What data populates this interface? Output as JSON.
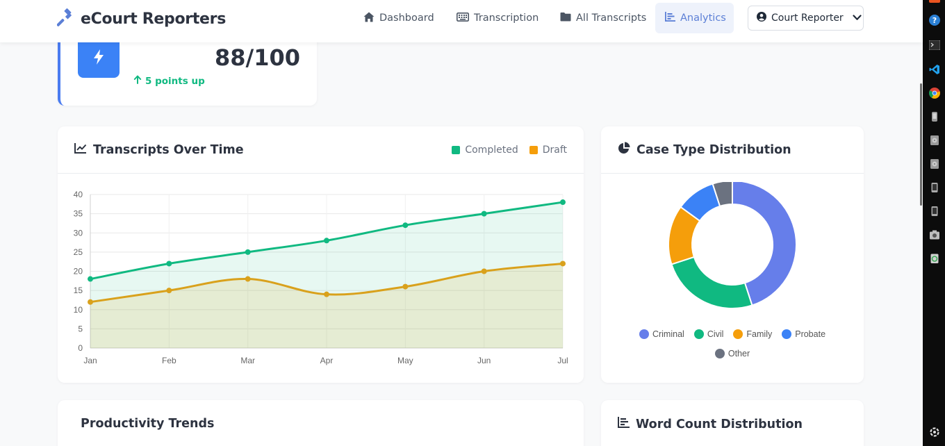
{
  "app": {
    "title": "eCourt Reporters"
  },
  "nav": {
    "items": [
      {
        "label": "Dashboard",
        "icon": "home-icon",
        "active": false
      },
      {
        "label": "Transcription",
        "icon": "keyboard-icon",
        "active": false
      },
      {
        "label": "All Transcripts",
        "icon": "folder-icon",
        "active": false
      },
      {
        "label": "Analytics",
        "icon": "chart-bar-icon",
        "active": true
      }
    ],
    "user_label": "Court Reporter"
  },
  "score_card": {
    "value": "88/100",
    "change": "5 points up",
    "icon": "lightning-icon",
    "accent": "#3b82f6"
  },
  "transcripts_chart": {
    "title": "Transcripts Over Time",
    "legend": [
      {
        "label": "Completed",
        "color": "#10b981"
      },
      {
        "label": "Draft",
        "color": "#f59e0b"
      }
    ]
  },
  "case_chart": {
    "title": "Case Type Distribution",
    "legend": [
      {
        "label": "Criminal",
        "color": "#667eea"
      },
      {
        "label": "Civil",
        "color": "#10b981"
      },
      {
        "label": "Family",
        "color": "#f59e0b"
      },
      {
        "label": "Probate",
        "color": "#3b82f6"
      },
      {
        "label": "Other",
        "color": "#6b7280"
      }
    ]
  },
  "productivity": {
    "title": "Productivity Trends"
  },
  "word_count": {
    "title": "Word Count Distribution"
  },
  "chart_data": [
    {
      "type": "line",
      "title": "Transcripts Over Time",
      "x": [
        "Jan",
        "Feb",
        "Mar",
        "Apr",
        "May",
        "Jun",
        "Jul"
      ],
      "series": [
        {
          "name": "Completed",
          "values": [
            18,
            22,
            25,
            28,
            32,
            35,
            38
          ],
          "color": "#10b981"
        },
        {
          "name": "Draft",
          "values": [
            12,
            15,
            18,
            14,
            16,
            20,
            22
          ],
          "color": "#d9a11c"
        }
      ],
      "yticks": [
        0,
        5,
        10,
        15,
        20,
        25,
        30,
        35,
        40
      ],
      "ylim": [
        0,
        40
      ],
      "grid": true,
      "fill": true
    },
    {
      "type": "pie",
      "title": "Case Type Distribution",
      "style": "doughnut",
      "labels": [
        "Criminal",
        "Civil",
        "Family",
        "Probate",
        "Other"
      ],
      "values": [
        45,
        25,
        15,
        10,
        5
      ],
      "colors": [
        "#667eea",
        "#10b981",
        "#f59e0b",
        "#3b82f6",
        "#6b7280"
      ],
      "legend_position": "bottom"
    }
  ]
}
